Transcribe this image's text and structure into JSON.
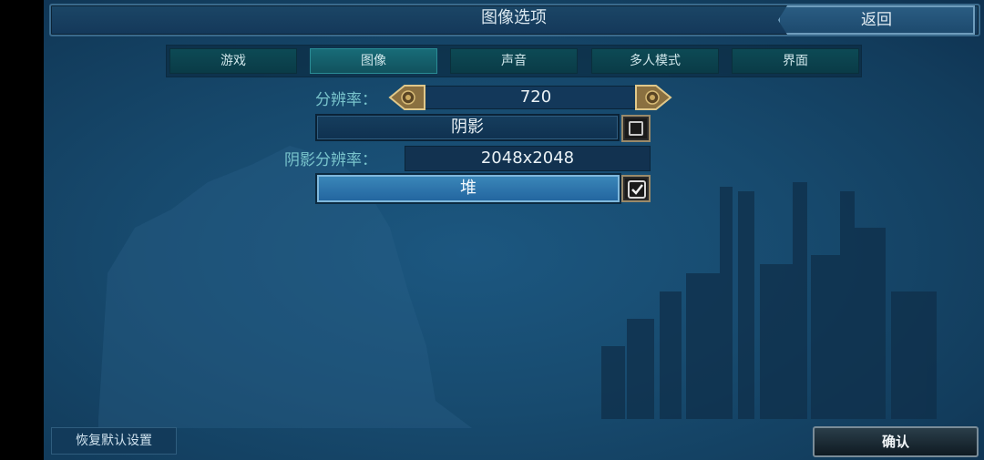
{
  "header": {
    "title": "图像选项",
    "back_label": "返回"
  },
  "tabs": [
    {
      "label": "游戏",
      "active": false
    },
    {
      "label": "图像",
      "active": true
    },
    {
      "label": "声音",
      "active": false
    },
    {
      "label": "多人模式",
      "active": false
    },
    {
      "label": "界面",
      "active": false
    }
  ],
  "settings": {
    "resolution_label": "分辨率：",
    "resolution_value": "720",
    "shadow_label": "阴影",
    "shadow_checked": false,
    "shadow_resolution_label": "阴影分辨率：",
    "shadow_resolution_value": "2048x2048",
    "stack_label": "堆",
    "stack_checked": true
  },
  "footer": {
    "reset_label": "恢复默认设置",
    "confirm_label": "确认"
  },
  "colors": {
    "background": "#174a6e",
    "label": "#79c4cc",
    "active_tab": "#186c78",
    "gold": "#b89a5a"
  }
}
